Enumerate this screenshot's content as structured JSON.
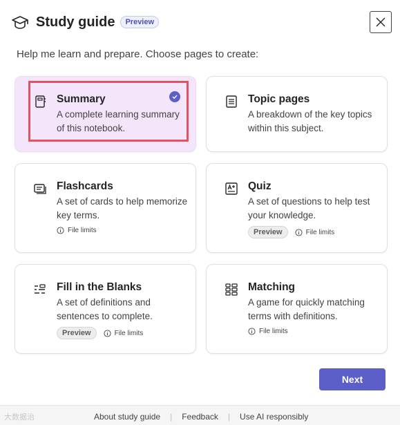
{
  "header": {
    "title": "Study guide",
    "badge": "Preview",
    "icon": "graduation-cap-icon",
    "close_icon": "close-icon"
  },
  "subtitle": "Help me learn and prepare. Choose pages to create:",
  "cards": {
    "summary": {
      "title": "Summary",
      "desc": "A complete learning summary of this notebook.",
      "icon": "notebook-icon",
      "selected": true
    },
    "topic": {
      "title": "Topic pages",
      "desc": "A breakdown of the key topics within this subject.",
      "icon": "document-lines-icon"
    },
    "flashcards": {
      "title": "Flashcards",
      "desc": "A set of cards to help memorize key terms.",
      "icon": "flashcards-icon",
      "file_limits": "File limits"
    },
    "quiz": {
      "title": "Quiz",
      "desc": "A set of questions to help test your knowledge.",
      "icon": "quiz-icon",
      "badge": "Preview",
      "file_limits": "File limits"
    },
    "blanks": {
      "title": "Fill in the Blanks",
      "desc": "A set of definitions and sentences to complete.",
      "icon": "fill-blanks-icon",
      "badge": "Preview",
      "file_limits": "File limits"
    },
    "matching": {
      "title": "Matching",
      "desc": "A game for quickly matching terms with definitions.",
      "icon": "matching-grid-icon",
      "file_limits": "File limits"
    }
  },
  "next_label": "Next",
  "footer": {
    "watermark": "大数据治",
    "links": [
      "About study guide",
      "Feedback",
      "Use AI responsibly"
    ]
  },
  "colors": {
    "accent": "#5b5fc7",
    "selected_bg": "#f4e5fb",
    "highlight": "#e2525f"
  }
}
